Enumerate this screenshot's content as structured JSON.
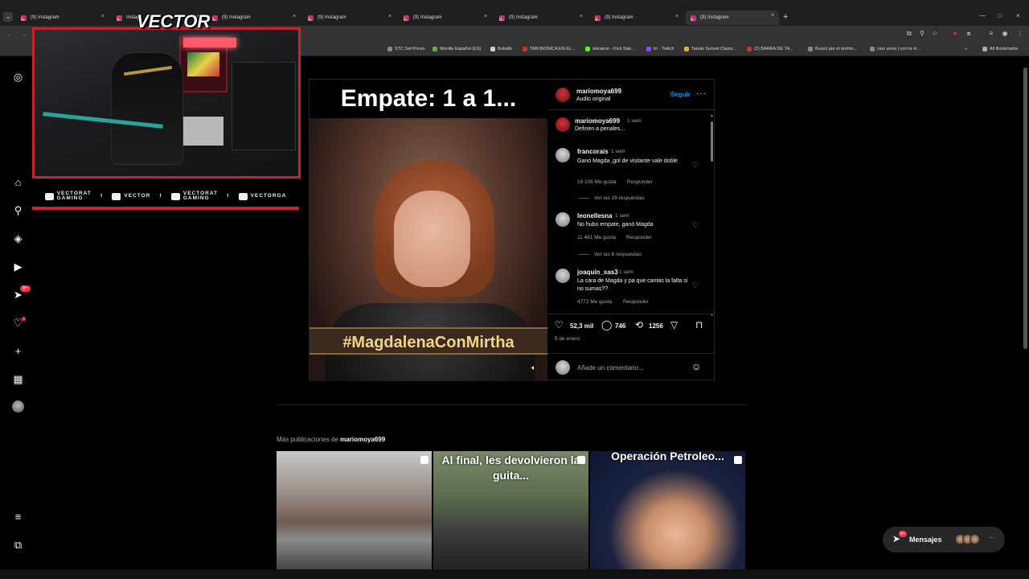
{
  "browser": {
    "tabs": [
      {
        "title": "(9) Instagram",
        "active": false
      },
      {
        "title": "Instagr",
        "active": false
      },
      {
        "title": "(9) Instagram",
        "active": false
      },
      {
        "title": "(9) Instagram",
        "active": false
      },
      {
        "title": "(9) Instagram",
        "active": false
      },
      {
        "title": "(9) Instagram",
        "active": false
      },
      {
        "title": "(9) Instagram",
        "active": false
      },
      {
        "title": "(9) Instagram",
        "active": true
      }
    ],
    "bookmarks": [
      "STC Set Prices",
      "Wordle Español (ES)",
      "Boludle",
      "TAN BIONICA EN EL...",
      "sionaron - Kick Stat...",
      "trr - Twitch",
      "Tanuki Sunset Classi...",
      "(2) BARRA DE TA...",
      "Buscó por el términ...",
      "cion arros | con la m...",
      "All Bookmarks"
    ]
  },
  "overlay": {
    "logo": "VECTOR",
    "socials": [
      {
        "top": "VECTORAT",
        "bottom": "GAMING"
      },
      {
        "top": "",
        "bottom": "VECTOR"
      },
      {
        "top": "VECTORAT",
        "bottom": "GAMING"
      },
      {
        "top": "",
        "bottom": "VECTORGA"
      }
    ],
    "separator": "I"
  },
  "sidebar": {
    "icons": [
      "instagram-icon",
      "home-icon",
      "search-icon",
      "explore-icon",
      "reels-icon",
      "messages-icon",
      "notifications-icon",
      "create-icon",
      "dashboard-icon",
      "profile-avatar",
      "menu-icon",
      "threads-icon"
    ],
    "messages_badge": "9+"
  },
  "post": {
    "media_caption": "Empate: 1 a 1...",
    "media_hashtag": "#MagdalenaConMirtha",
    "author": "mariomoya699",
    "audio": "Audio original",
    "follow_label": "Seguir",
    "comments": [
      {
        "user": "mariomoya699",
        "time": "1 sem",
        "text": "Definen a penales...",
        "likes": "",
        "reply": "",
        "view_replies": ""
      },
      {
        "user": "francorais",
        "time": "1 sem",
        "text": "Ganó Magda ,gol de visitante vale doble",
        "likes": "18 106 Me gusta",
        "reply": "Responder",
        "view_replies": "Ver las 29 respuestas"
      },
      {
        "user": "leonellesna",
        "time": "1 sem",
        "text": "No hubo empate, ganó Magda",
        "likes": "11 481 Me gusta",
        "reply": "Responder",
        "view_replies": "Ver las 8 respuestas"
      },
      {
        "user": "joaquin_sas3",
        "time": "1 sem",
        "text": "La cara de Magda y pa que cantas la falta si no sumas??",
        "likes": "4772 Me gusta",
        "reply": "Responder",
        "view_replies": ""
      }
    ],
    "likes_count": "52,3 mil",
    "comments_count": "746",
    "reposts_count": "1256",
    "date": "5 de enero",
    "add_comment_placeholder": "Añade un comentario..."
  },
  "more_posts": {
    "prefix": "Más publicaciones de",
    "user": "mariomoya699",
    "thumbnails": [
      {
        "caption": ""
      },
      {
        "caption": "Al final, les devolvieron la guita..."
      },
      {
        "caption": "Operación Petroleo..."
      }
    ]
  },
  "messages_widget": {
    "label": "Mensajes",
    "badge": "9+"
  }
}
